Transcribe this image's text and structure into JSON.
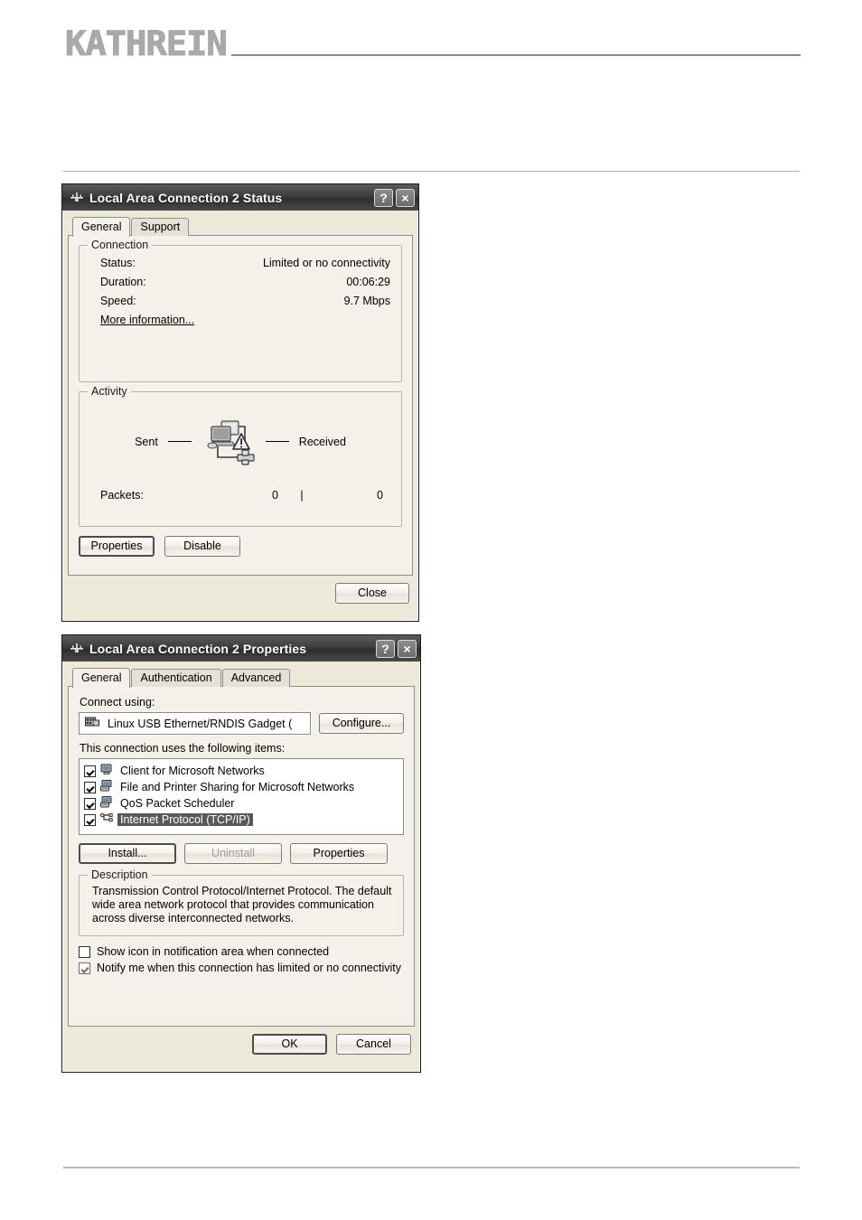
{
  "page": {
    "logo": "KATHREIN"
  },
  "status_dialog": {
    "title": "Local Area Connection 2 Status",
    "title_icon": "network-connection-icon",
    "help_button": "?",
    "close_button": "×",
    "tabs": [
      {
        "label": "General",
        "active": true
      },
      {
        "label": "Support",
        "active": false
      }
    ],
    "connection_group": {
      "legend": "Connection",
      "rows": [
        {
          "key": "Status:",
          "value": "Limited or no connectivity"
        },
        {
          "key": "Duration:",
          "value": "00:06:29"
        },
        {
          "key": "Speed:",
          "value": "9.7 Mbps"
        }
      ],
      "more_information": "More information..."
    },
    "activity_group": {
      "legend": "Activity",
      "sent_label": "Sent",
      "received_label": "Received",
      "icon": "two-computers-network-warning-icon",
      "packets_label": "Packets:",
      "packets_sent": "0",
      "packets_separator": "|",
      "packets_received": "0"
    },
    "buttons": {
      "properties": "Properties",
      "disable": "Disable",
      "close": "Close"
    }
  },
  "properties_dialog": {
    "title": "Local Area Connection 2 Properties",
    "title_icon": "network-connection-icon",
    "help_button": "?",
    "close_button": "×",
    "tabs": [
      {
        "label": "General",
        "active": true
      },
      {
        "label": "Authentication",
        "active": false
      },
      {
        "label": "Advanced",
        "active": false
      }
    ],
    "connect_using_label": "Connect using:",
    "adapter": {
      "icon": "network-adapter-card-icon",
      "name": "Linux USB Ethernet/RNDIS Gadget ("
    },
    "configure_button": "Configure...",
    "items_label": "This connection uses the following items:",
    "items": [
      {
        "label": "Client for Microsoft Networks",
        "checked": true,
        "selected": false,
        "icon": "computer-icon"
      },
      {
        "label": "File and Printer Sharing for Microsoft Networks",
        "checked": true,
        "selected": false,
        "icon": "computer-share-icon"
      },
      {
        "label": "QoS Packet Scheduler",
        "checked": true,
        "selected": false,
        "icon": "computer-share-icon"
      },
      {
        "label": "Internet Protocol (TCP/IP)",
        "checked": true,
        "selected": true,
        "icon": "protocol-icon"
      }
    ],
    "item_buttons": {
      "install": "Install...",
      "uninstall": "Uninstall",
      "uninstall_disabled": true,
      "properties": "Properties"
    },
    "description_group": {
      "legend": "Description",
      "text": "Transmission Control Protocol/Internet Protocol. The default wide area network protocol that provides communication across diverse interconnected networks."
    },
    "options": [
      {
        "label": "Show icon in notification area when connected",
        "checked": false
      },
      {
        "label": "Notify me when this connection has limited or no connectivity",
        "checked": true,
        "style": "light"
      }
    ],
    "buttons": {
      "ok": "OK",
      "cancel": "Cancel"
    }
  }
}
